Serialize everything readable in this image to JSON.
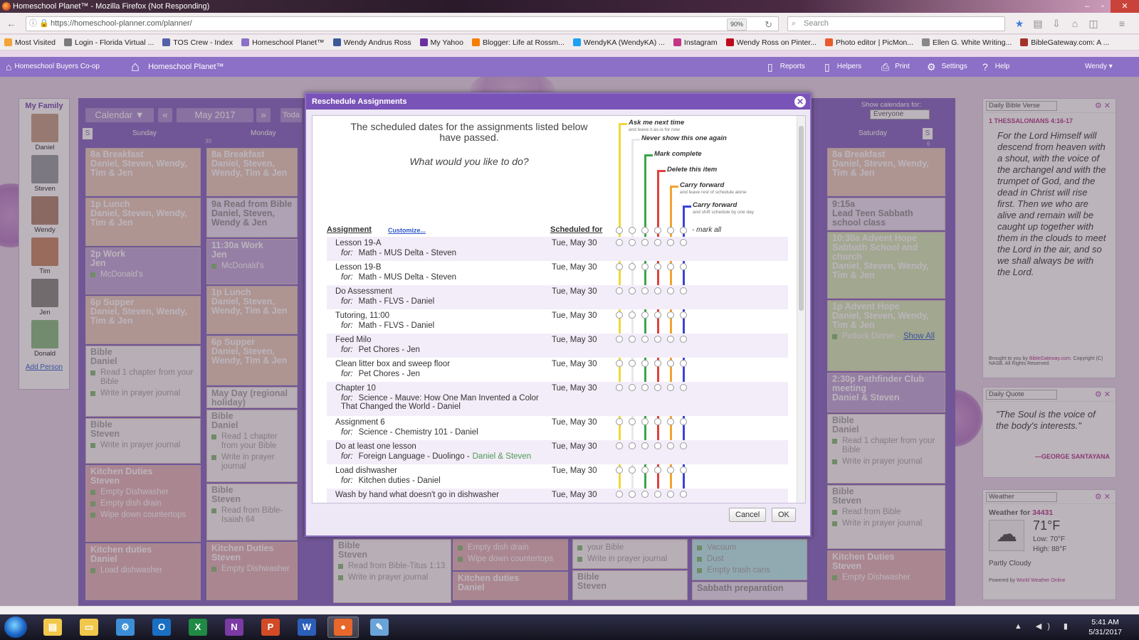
{
  "window": {
    "title": "Homeschool Planet™ - Mozilla Firefox (Not Responding)"
  },
  "browser": {
    "url": "https://homeschool-planner.com/planner/",
    "zoom": "90%",
    "search_placeholder": "Search",
    "bookmarks": [
      {
        "label": "Most Visited",
        "color": "#f2a43a"
      },
      {
        "label": "Login - Florida Virtual ...",
        "color": "#7a7a7a"
      },
      {
        "label": "TOS Crew - Index",
        "color": "#5560a8"
      },
      {
        "label": "Homeschool Planet™",
        "color": "#8c6fc6"
      },
      {
        "label": "Wendy Andrus Ross",
        "color": "#3b5998"
      },
      {
        "label": "My Yahoo",
        "color": "#6b2fa0"
      },
      {
        "label": "Blogger: Life at Rossm...",
        "color": "#f57d00"
      },
      {
        "label": "WendyKA (WendyKA) ...",
        "color": "#1da1f2"
      },
      {
        "label": "Instagram",
        "color": "#c13584"
      },
      {
        "label": "Wendy Ross on Pinter...",
        "color": "#bd081c"
      },
      {
        "label": "Photo editor | PicMon...",
        "color": "#e85b2b"
      },
      {
        "label": "Ellen G. White Writing...",
        "color": "#888888"
      },
      {
        "label": "BibleGateway.com: A ...",
        "color": "#a3322a"
      }
    ]
  },
  "app": {
    "brand_coop": "Homeschool Buyers Co-op",
    "brand_planet": "Homeschool Planet™",
    "menu": [
      "Reports",
      "Helpers",
      "Print",
      "Settings",
      "Help"
    ],
    "user": "Wendy ▾"
  },
  "family": {
    "title": "My Family",
    "members": [
      {
        "name": "Daniel",
        "color": "#c9a58e"
      },
      {
        "name": "Steven",
        "color": "#9fa3a7"
      },
      {
        "name": "Wendy",
        "color": "#b58c78"
      },
      {
        "name": "Tim",
        "color": "#c98f6e"
      },
      {
        "name": "Jen",
        "color": "#8f8f88"
      },
      {
        "name": "Donald",
        "color": "#8fc089"
      }
    ],
    "add_label": "Add Person"
  },
  "calendar": {
    "view_label": "Calendar ▼",
    "prev": "«",
    "next": "»",
    "month": "May 2017",
    "today": "Toda",
    "show_label": "Show calendars for:",
    "show_value": "Everyone",
    "days": {
      "sunday": "Sunday",
      "monday": "Monday",
      "saturday": "Saturday"
    },
    "s_left": "S",
    "s_right": "S",
    "num_30": "30",
    "num_6": "6"
  },
  "sunday_cells": [
    {
      "title": "8a Breakfast",
      "body": "Daniel, Steven, Wendy, Tim & Jen"
    },
    {
      "title": "1p Lunch",
      "body": "Daniel, Steven, Wendy, Tim & Jen"
    },
    {
      "title": "2p Work",
      "body": "Jen",
      "sub": "McDonald's"
    },
    {
      "title": "6p Supper",
      "body": "Daniel, Steven, Wendy, Tim & Jen"
    },
    {
      "title": "Bible",
      "body": "Daniel",
      "subs": [
        "Read 1 chapter from your Bible",
        "Write in prayer journal"
      ]
    },
    {
      "title": "Bible",
      "body": "Steven",
      "subs": [
        "Write in prayer journal"
      ]
    },
    {
      "title": "Kitchen Duties",
      "body": "Steven",
      "subs": [
        "Empty Dishwasher",
        "Empty dish drain",
        "Wipe down countertops"
      ]
    },
    {
      "title": "Kitchen duties",
      "body": "Daniel",
      "subs": [
        "Load dishwasher"
      ]
    }
  ],
  "monday_cells": [
    {
      "title": "8a Breakfast",
      "body": "Daniel, Steven, Wendy, Tim & Jen"
    },
    {
      "title": "9a Read from Bible",
      "body": "Daniel, Steven, Wendy & Jen"
    },
    {
      "title": "11:30a Work",
      "body": "Jen",
      "sub": "McDonald's"
    },
    {
      "title": "1p Lunch",
      "body": "Daniel, Steven, Wendy, Tim & Jen"
    },
    {
      "title": "6p Supper",
      "body": "Daniel, Steven, Wendy, Tim & Jen"
    },
    {
      "title": "May Day (regional holiday)"
    },
    {
      "title": "Bible",
      "body": "Daniel",
      "subs": [
        "Read 1 chapter from your Bible",
        "Write in prayer journal"
      ]
    },
    {
      "title": "Bible",
      "body": "Steven",
      "subs": [
        "Read from Bible-Isaiah 64"
      ]
    },
    {
      "title": "Kitchen Duties",
      "body": "Steven",
      "subs": [
        "Empty Dishwasher"
      ]
    }
  ],
  "saturday_cells": [
    {
      "title": "8a Breakfast",
      "body": "Daniel, Steven, Wendy, Tim & Jen"
    },
    {
      "title": "9:15a",
      "body": "Lead Teen Sabbath school class"
    },
    {
      "title": "10:30a Advent Hope Sabbath School and church",
      "body": "Daniel, Steven, Wendy, Tim & Jen"
    },
    {
      "title": "1p Advent Hope",
      "body": "Daniel, Steven, Wendy, Tim & Jen",
      "sub": "Potluck Dinner -",
      "link": "Show All"
    },
    {
      "title": "2:30p Pathfinder Club meeting",
      "body": "Daniel & Steven"
    },
    {
      "title": "Bible",
      "body": "Daniel",
      "subs": [
        "Read 1 chapter from your Bible",
        "Write in prayer journal"
      ]
    },
    {
      "title": "Bible",
      "body": "Steven",
      "subs": [
        "Read from Bible",
        "Write in prayer journal"
      ]
    },
    {
      "title": "Kitchen Duties",
      "body": "Steven",
      "subs": [
        "Empty Dishwasher"
      ]
    }
  ],
  "bottom_cells": {
    "tue_bible": {
      "title": "Bible",
      "body": "Steven",
      "subs": [
        "Read from Bible-Titus 1:13",
        "Write in prayer journal"
      ]
    },
    "wed_top": {
      "subs": [
        "Empty dish drain",
        "Wipe down countertops"
      ]
    },
    "wed_kitchen": {
      "title": "Kitchen duties",
      "body": "Daniel"
    },
    "thu_top": {
      "subs": [
        "your Bible",
        "Write in prayer journal"
      ]
    },
    "thu_bible": {
      "title": "Bible",
      "body": "Steven"
    },
    "fri_top": {
      "subs": [
        "Vacuum",
        "Dust",
        "Empty trash cans"
      ]
    },
    "fri_sabbath": {
      "title": "Sabbath preparation"
    }
  },
  "widgets": {
    "bible": {
      "select": "Daily Bible Verse",
      "ref": "1 Thessalonians 4:16-17",
      "text": "For the Lord Himself will descend from heaven with a shout, with the voice of the archangel and with the trumpet of God, and the dead in Christ will rise first. Then we who are alive and remain will be caught up together with them in the clouds to meet the Lord in the air, and so we shall always be with the Lord.",
      "credit_pre": "Brought to you by",
      "credit_link": "BibleGateway.com",
      "credit_post": ". Copyright (C) NASB. All Rights Reserved."
    },
    "quote": {
      "select": "Daily Quote",
      "text": "\"The Soul is the voice of the body's interests.\"",
      "author": "—George Santayana"
    },
    "weather": {
      "select": "Weather",
      "label": "Weather for",
      "zip": "34431",
      "temp": "71°F",
      "low": "Low: 70°F",
      "high": "High: 88°F",
      "condition": "Partly Cloudy",
      "powered_pre": "Powered by",
      "powered_link": "World Weather Online"
    }
  },
  "dialog": {
    "title": "Reschedule Assignments",
    "message": "The scheduled dates for the assignments listed below have passed.",
    "question": "What would you like to do?",
    "options": [
      {
        "label": "Ask me next time",
        "sub": "and leave it as-is for now",
        "color": "#f0d83a"
      },
      {
        "label": "Never show this one again",
        "sub": "",
        "color": "#e9e6ee"
      },
      {
        "label": "Mark complete",
        "sub": "",
        "color": "#3aa64a"
      },
      {
        "label": "Delete this item",
        "sub": "",
        "color": "#e0403e"
      },
      {
        "label": "Carry forward",
        "sub": "and leave rest of schedule alone",
        "color": "#f2a42e"
      },
      {
        "label": "Carry forward",
        "sub": "and shift schedule by one day",
        "color": "#3b44d6"
      }
    ],
    "header_assignment": "Assignment",
    "header_customize": "Customize...",
    "header_scheduled": "Scheduled for",
    "mark_all": "- mark all",
    "for_label": "for:",
    "rows": [
      {
        "name": "Lesson 19-A",
        "for": "Math - MUS Delta - Steven",
        "date": "Tue, May 30"
      },
      {
        "name": "Lesson 19-B",
        "for": "Math - MUS Delta - Steven",
        "date": "Tue, May 30"
      },
      {
        "name": "Do Assessment",
        "for": "Math - FLVS - Daniel",
        "date": "Tue, May 30"
      },
      {
        "name": "Tutoring, 11:00",
        "for": "Math - FLVS - Daniel",
        "date": "Tue, May 30"
      },
      {
        "name": "Feed Milo",
        "for": "Pet Chores - Jen",
        "date": "Tue, May 30"
      },
      {
        "name": "Clean litter box and sweep floor",
        "for": "Pet Chores - Jen",
        "date": "Tue, May 30"
      },
      {
        "name": "Chapter 10",
        "for": "Science - Mauve: How One Man Invented a Color That Changed the World - Daniel",
        "date": "Tue, May 30"
      },
      {
        "name": "Assignment 6",
        "for": "Science - Chemistry 101 - Daniel",
        "date": "Tue, May 30"
      },
      {
        "name": "Do at least one lesson",
        "for": "Foreign Language - Duolingo -",
        "for_extra": "Daniel & Steven",
        "date": "Tue, May 30"
      },
      {
        "name": "Load dishwasher",
        "for": "Kitchen duties - Daniel",
        "date": "Tue, May 30"
      },
      {
        "name": "Wash by hand what doesn't go in dishwasher",
        "for": "",
        "date": "Tue, May 30"
      }
    ],
    "cancel": "Cancel",
    "ok": "OK"
  },
  "taskbar": {
    "apps": [
      "Explorer",
      "Folder",
      "Control Panel",
      "Outlook",
      "Excel",
      "OneNote",
      "PowerPoint",
      "Word",
      "Firefox",
      "Paint"
    ],
    "app_glyphs": [
      "▤",
      "▭",
      "⚙",
      "O",
      "X",
      "N",
      "P",
      "W",
      "●",
      "✎"
    ],
    "time": "5:41 AM",
    "date": "5/31/2017"
  }
}
